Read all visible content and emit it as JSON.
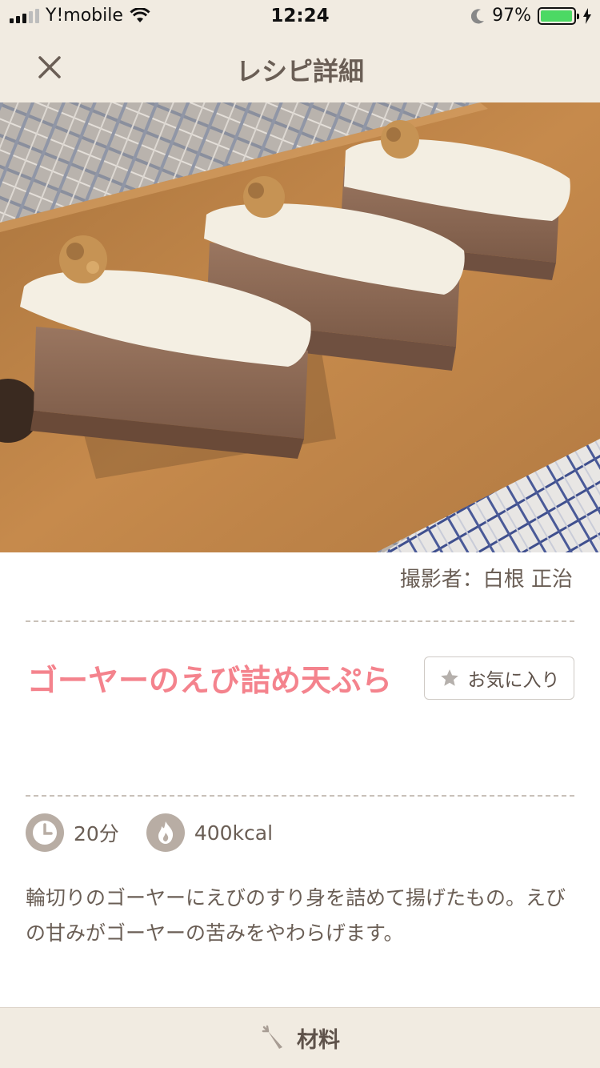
{
  "status_bar": {
    "carrier": "Y!mobile",
    "time": "12:24",
    "battery_percent": "97%",
    "battery_level": 0.97,
    "icons": [
      "signal-icon",
      "wifi-icon",
      "moon-icon",
      "battery-icon",
      "charging-icon"
    ]
  },
  "nav": {
    "title": "レシピ詳細",
    "close_icon": "close-icon"
  },
  "photo": {
    "credit": "撮影者：白根 正治"
  },
  "recipe": {
    "title": "ゴーヤーのえび詰め天ぷら",
    "favorite_label": "お気に入り",
    "time": "20分",
    "calories": "400kcal",
    "description": "輪切りのゴーヤーにえびのすり身を詰めて揚げたもの。えびの甘みがゴーヤーの苦みをやわらげます。"
  },
  "bottom_tab": {
    "label": "材料",
    "icon": "carrot-icon"
  },
  "colors": {
    "header_bg": "#f1ebe1",
    "title_pink": "#f4838d",
    "text_brown": "#6a5e55",
    "icon_circle": "#b8ada4"
  }
}
